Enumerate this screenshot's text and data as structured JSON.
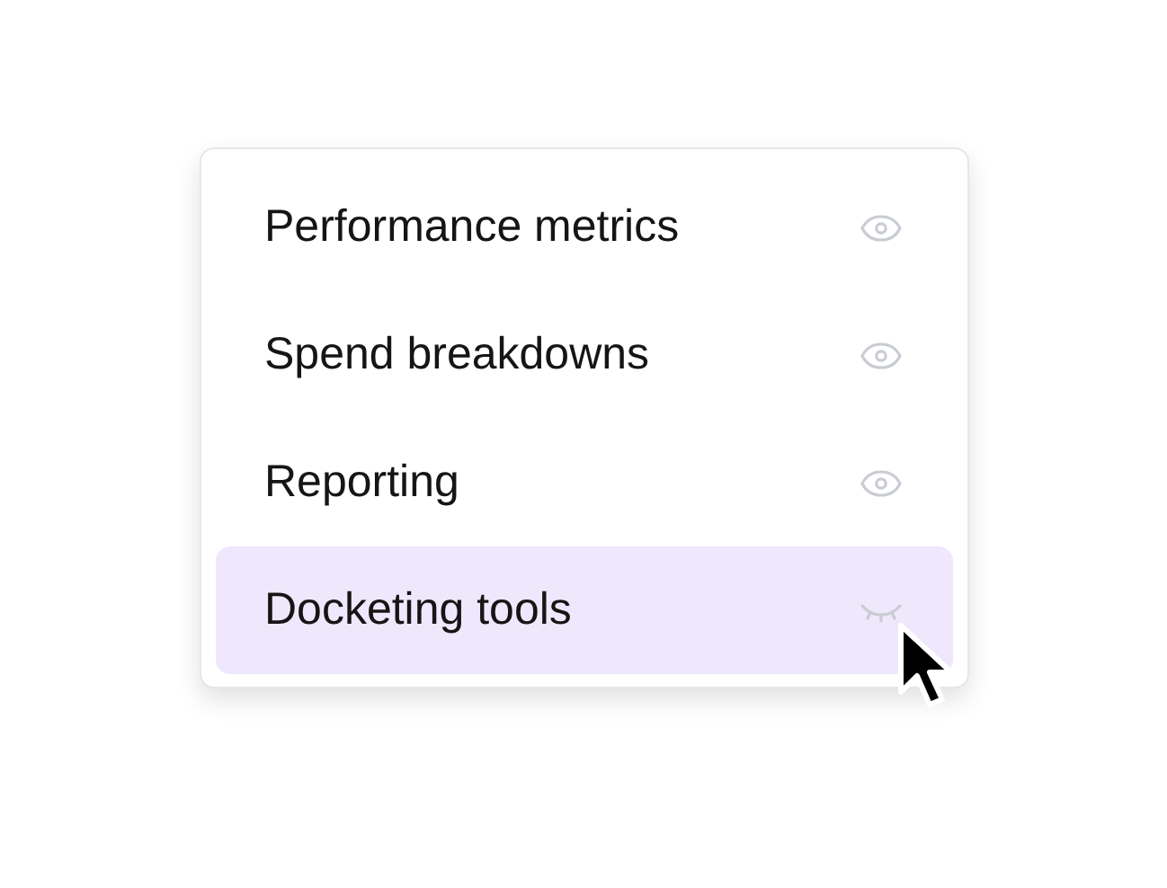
{
  "menu": {
    "items": [
      {
        "label": "Performance metrics",
        "visible": true,
        "selected": false
      },
      {
        "label": "Spend breakdowns",
        "visible": true,
        "selected": false
      },
      {
        "label": "Reporting",
        "visible": true,
        "selected": false
      },
      {
        "label": "Docketing tools",
        "visible": false,
        "selected": true
      }
    ]
  }
}
